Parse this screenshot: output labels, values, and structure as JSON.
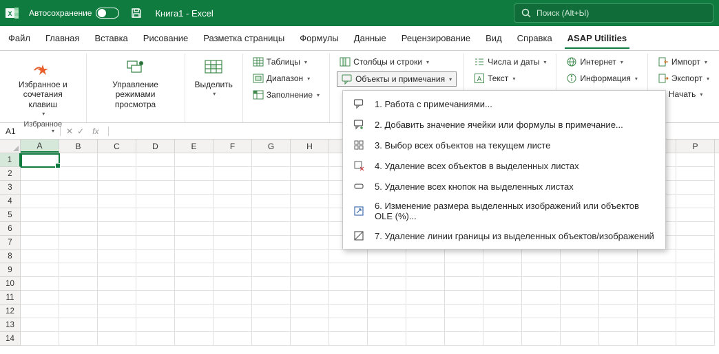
{
  "title": {
    "autosave": "Автосохранение",
    "file": "Книга1",
    "appsuffix": " - Excel",
    "search": "Поиск (Alt+Ы)"
  },
  "tabs": [
    "Файл",
    "Главная",
    "Вставка",
    "Рисование",
    "Разметка страницы",
    "Формулы",
    "Данные",
    "Рецензирование",
    "Вид",
    "Справка",
    "ASAP Utilities"
  ],
  "ribbon": {
    "favorites": {
      "label": "Избранное и\nсочетания клавиш",
      "group": "Избранное"
    },
    "modes": {
      "label": "Управление\nрежимами просмотра"
    },
    "select": {
      "label": "Выделить"
    },
    "tables": {
      "label": "Таблицы"
    },
    "range": {
      "label": "Диапазон"
    },
    "fill": {
      "label": "Заполнение"
    },
    "colsrows": {
      "label": "Столбцы и строки"
    },
    "objects": {
      "label": "Объекты и примечания"
    },
    "numdates": {
      "label": "Числа и даты"
    },
    "text": {
      "label": "Текст"
    },
    "internet": {
      "label": "Интернет"
    },
    "info": {
      "label": "Информация"
    },
    "import": {
      "label": "Импорт"
    },
    "export": {
      "label": "Экспорт"
    },
    "start": {
      "label": "Начать"
    }
  },
  "menu": [
    "1. Работа с примечаниями...",
    "2. Добавить значение ячейки или формулы в примечание...",
    "3. Выбор всех объектов на текущем листе",
    "4. Удаление всех объектов в выделенных листах",
    "5. Удаление всех кнопок на выделенных листах",
    "6. Изменение размера выделенных изображений или объектов OLE (%)...",
    "7. Удаление линии границы из выделенных объектов/изображений"
  ],
  "grid": {
    "namebox": "A1",
    "cols": [
      "A",
      "B",
      "C",
      "D",
      "E",
      "F",
      "G",
      "H",
      "",
      "",
      "",
      "",
      "",
      "",
      "",
      "",
      "",
      "P"
    ],
    "rowcount": 14
  }
}
